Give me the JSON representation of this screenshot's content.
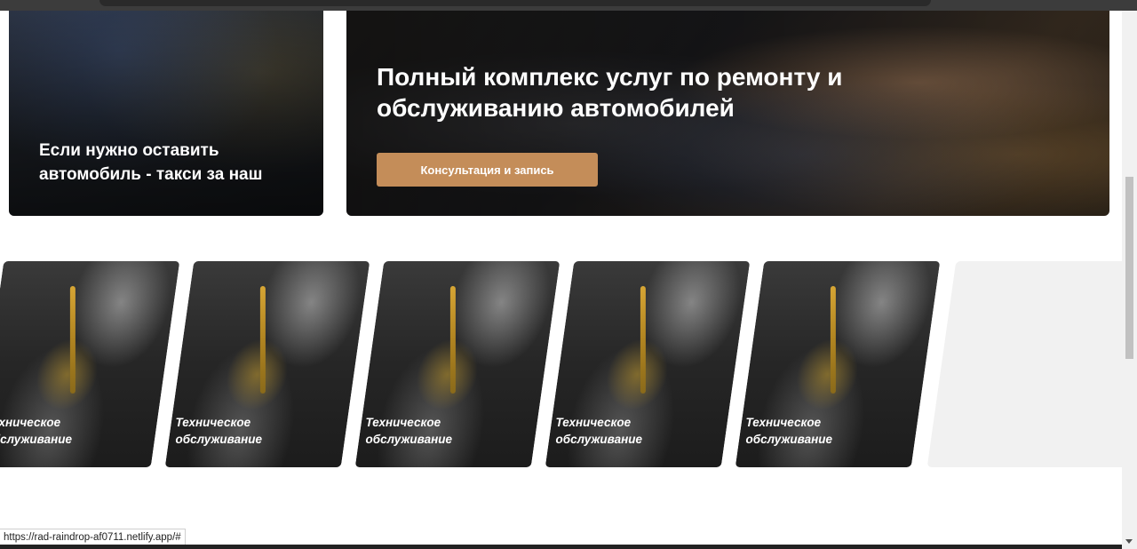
{
  "hero": {
    "left_card": {
      "title": "Если нужно оставить автомобиль - такси за наш"
    },
    "right_card": {
      "title": "Полный комплекс услуг по ремонту и обслуживанию автомобилей",
      "button_label": "Консультация и запись"
    }
  },
  "carousel": {
    "slides": [
      {
        "label": "Техническое обслуживание"
      },
      {
        "label": "Техническое обслуживание"
      },
      {
        "label": "Техническое обслуживание"
      },
      {
        "label": "Техническое обслуживание"
      },
      {
        "label": "Техническое обслуживание"
      }
    ]
  },
  "status_bar": {
    "url": "https://rad-raindrop-af0711.netlify.app/#"
  },
  "colors": {
    "accent": "#c48d59",
    "page_background": "#ffffff",
    "carousel_placeholder": "#f1f1f1"
  }
}
